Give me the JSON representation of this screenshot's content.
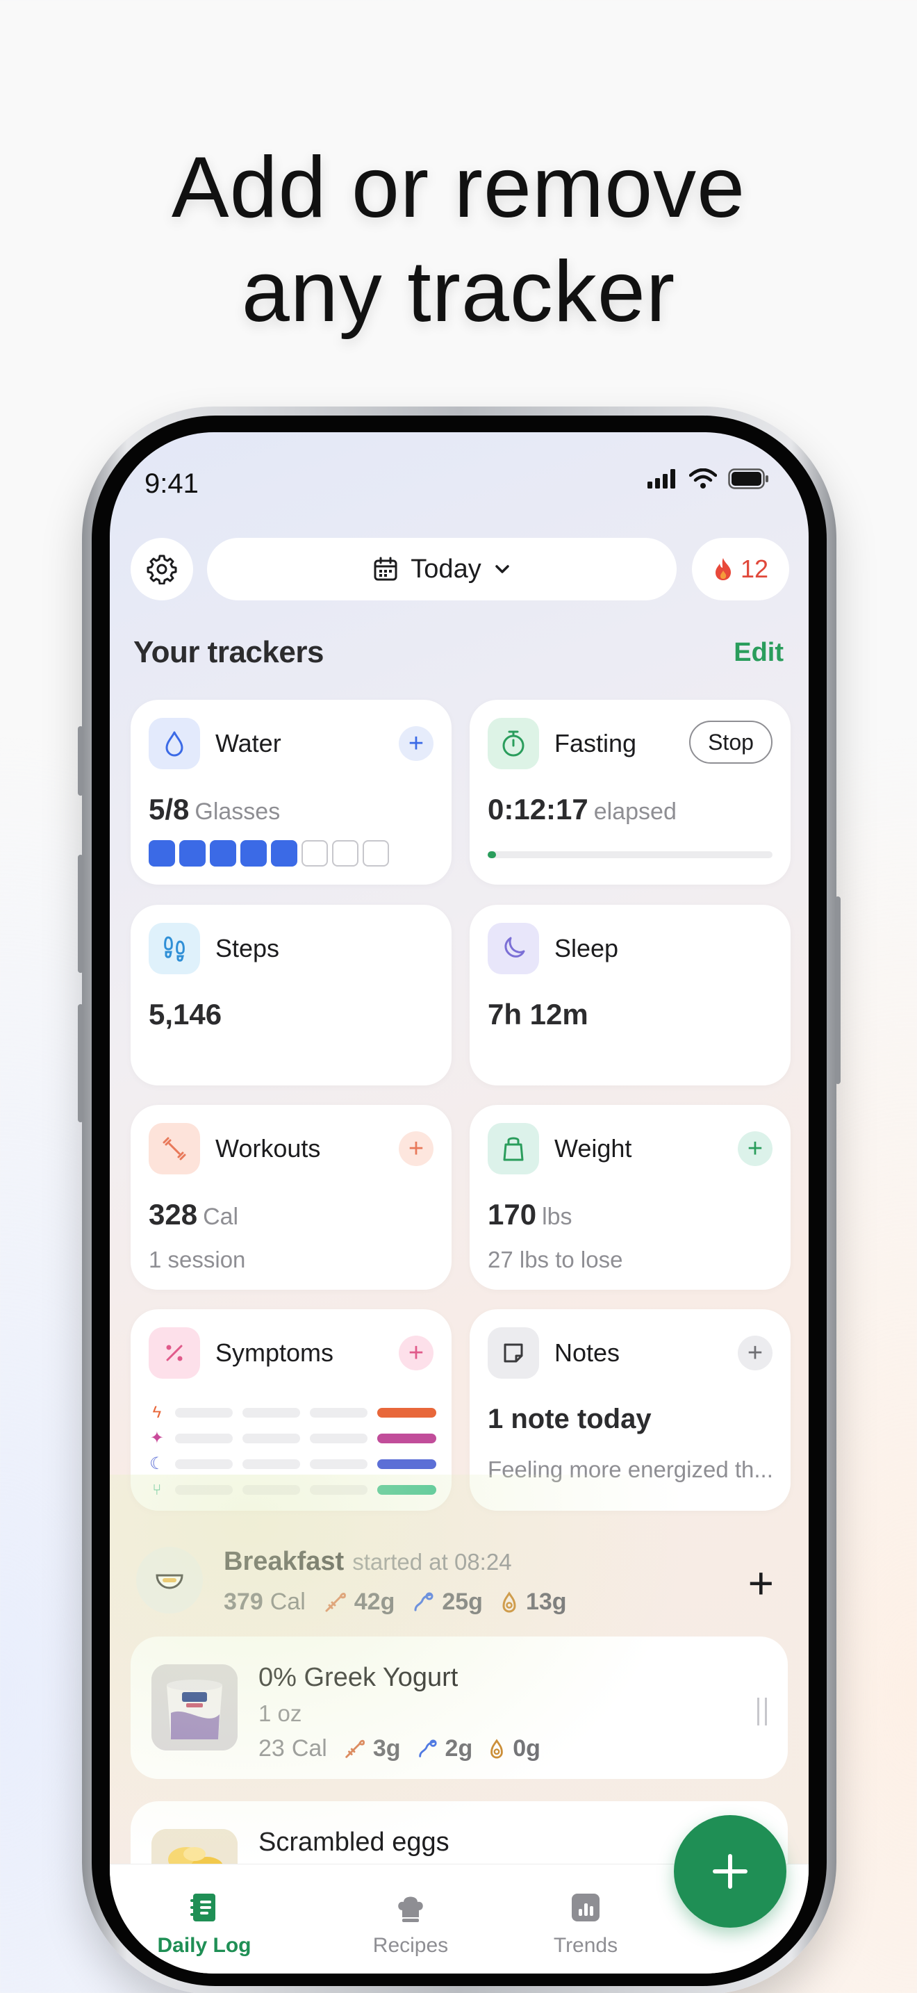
{
  "headline": {
    "line1": "Add or remove",
    "line2": "any tracker"
  },
  "status_bar": {
    "time": "9:41"
  },
  "header": {
    "date_label": "Today",
    "streak_count": "12"
  },
  "trackers_section": {
    "title": "Your trackers",
    "edit_label": "Edit"
  },
  "trackers": {
    "water": {
      "title": "Water",
      "value": "5/8",
      "unit": "Glasses",
      "filled": 5,
      "total": 8,
      "add_label": "+"
    },
    "fasting": {
      "title": "Fasting",
      "stop_label": "Stop",
      "value": "0:12:17",
      "unit": "elapsed",
      "progress": 0.02
    },
    "steps": {
      "title": "Steps",
      "value": "5,146"
    },
    "sleep": {
      "title": "Sleep",
      "value": "7h 12m"
    },
    "workouts": {
      "title": "Workouts",
      "value": "328",
      "unit": "Cal",
      "sub": "1 session",
      "add_label": "+"
    },
    "weight": {
      "title": "Weight",
      "value": "170",
      "unit": "lbs",
      "sub": "27 lbs to lose",
      "add_label": "+"
    },
    "symptoms": {
      "title": "Symptoms",
      "add_label": "+"
    },
    "notes": {
      "title": "Notes",
      "value": "1 note today",
      "sub": "Feeling more energized th...",
      "add_label": "+"
    }
  },
  "meal": {
    "name": "Breakfast",
    "started": "started at 08:24",
    "calories": "379",
    "cal_unit": "Cal",
    "protein": "42g",
    "carbs": "25g",
    "fat": "13g",
    "add_label": "+"
  },
  "foods": [
    {
      "name": "0% Greek Yogurt",
      "qty": "1 oz",
      "calories": "23",
      "cal_unit": "Cal",
      "protein": "3g",
      "carbs": "2g",
      "fat": "0g"
    },
    {
      "name": "Scrambled eggs"
    }
  ],
  "tabs": [
    {
      "label": "Daily Log"
    },
    {
      "label": "Recipes"
    },
    {
      "label": "Trends"
    }
  ],
  "colors": {
    "accent_green": "#1f8f55",
    "water_blue": "#3b6ae6",
    "streak_red": "#e0483a",
    "workout_orange": "#e8795a",
    "sleep_purple": "#7b6fd6",
    "symptom_pink": "#e05a8a"
  }
}
